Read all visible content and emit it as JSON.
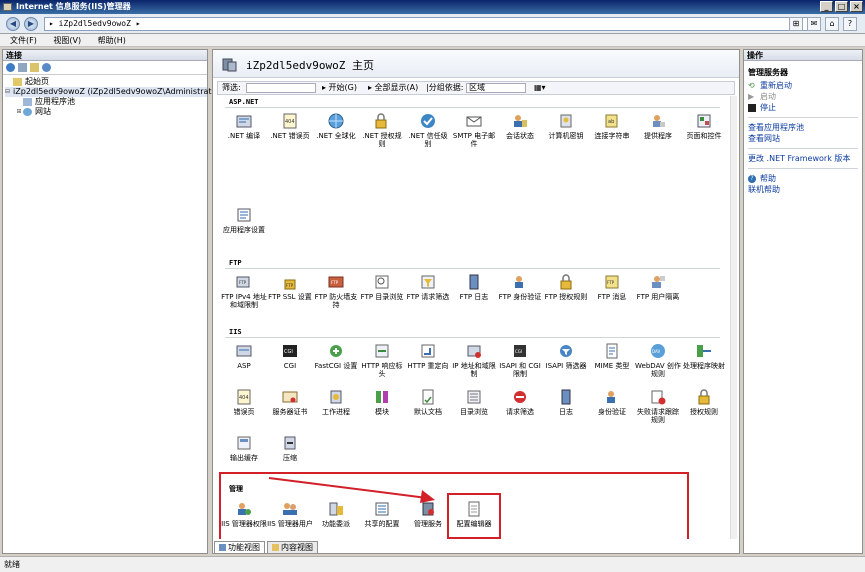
{
  "window": {
    "title": "Internet 信息服务(IIS)管理器",
    "controls": [
      "_",
      "□",
      "×"
    ]
  },
  "address": {
    "path": "▸ iZp2dl5edv9owoZ ▸",
    "right_tools": [
      "⊞",
      "✉",
      "⌂",
      "?"
    ]
  },
  "menu": [
    "文件(F)",
    "视图(V)",
    "帮助(H)"
  ],
  "connections": {
    "header": "连接",
    "tree": [
      {
        "label": "起始页",
        "level": 0,
        "toggle": ""
      },
      {
        "label": "iZp2dl5edv9owoZ (iZp2dl5edv9owoZ\\Administrator)",
        "level": 0,
        "toggle": "⊟"
      },
      {
        "label": "应用程序池",
        "level": 1,
        "toggle": ""
      },
      {
        "label": "网站",
        "level": 1,
        "toggle": "⊞"
      }
    ]
  },
  "main": {
    "title": "iZp2dl5edv9owoZ 主页",
    "filter_label": "筛选:",
    "go": "▸ 开始(G)",
    "show_all": "▸ 全部显示(A)",
    "group_by": "|分组依据:",
    "group_value": "区域",
    "sections": [
      {
        "title": "ASP.NET",
        "items": [
          ".NET 编译",
          ".NET 错误页",
          ".NET 全球化",
          ".NET 授权规则",
          ".NET 信任级别",
          "SMTP 电子邮件",
          "会话状态",
          "计算机密钥",
          "连接字符串",
          "提供程序",
          "页面和控件",
          "应用程序设置"
        ]
      },
      {
        "title": "FTP",
        "items": [
          "FTP IPv4 地址和域限制",
          "FTP SSL 设置",
          "FTP 防火墙支持",
          "FTP 目录浏览",
          "FTP 请求筛选",
          "FTP 日志",
          "FTP 身份验证",
          "FTP 授权规则",
          "FTP 消息",
          "FTP 用户隔离"
        ]
      },
      {
        "title": "IIS",
        "items": [
          "ASP",
          "CGI",
          "FastCGI 设置",
          "HTTP 响应标头",
          "HTTP 重定向",
          "IP 地址和域限制",
          "ISAPI 和 CGI 限制",
          "ISAPI 筛选器",
          "MIME 类型",
          "WebDAV 创作规则",
          "处理程序映射",
          "错误页",
          "服务器证书",
          "工作进程",
          "模块",
          "默认文档",
          "目录浏览",
          "请求筛选",
          "日志",
          "身份验证",
          "失败请求跟踪规则",
          "授权规则",
          "输出缓存",
          "压缩"
        ]
      },
      {
        "title": "管理",
        "items": [
          "IIS 管理器权限",
          "IIS 管理器用户",
          "功能委派",
          "共享的配置",
          "管理服务",
          "配置编辑器"
        ]
      }
    ]
  },
  "bottom_tabs": [
    "功能视图",
    "内容视图"
  ],
  "actions": {
    "header": "操作",
    "groups": [
      {
        "title": "管理服务器",
        "items": [
          {
            "label": "重新启动",
            "enabled": true
          },
          {
            "label": "启动",
            "enabled": false
          },
          {
            "label": "停止",
            "enabled": true
          }
        ]
      },
      {
        "title": "",
        "items": [
          {
            "label": "查看应用程序池",
            "enabled": true
          },
          {
            "label": "查看网站",
            "enabled": true
          }
        ]
      },
      {
        "title": "",
        "items": [
          {
            "label": "更改 .NET Framework 版本",
            "enabled": true
          }
        ]
      },
      {
        "title": "",
        "items": [
          {
            "label": "帮助",
            "enabled": true
          },
          {
            "label": "联机帮助",
            "enabled": true
          }
        ]
      }
    ]
  },
  "status": "就绪",
  "colors": {
    "highlight": "#d21f28",
    "link": "#0b3b9f"
  }
}
